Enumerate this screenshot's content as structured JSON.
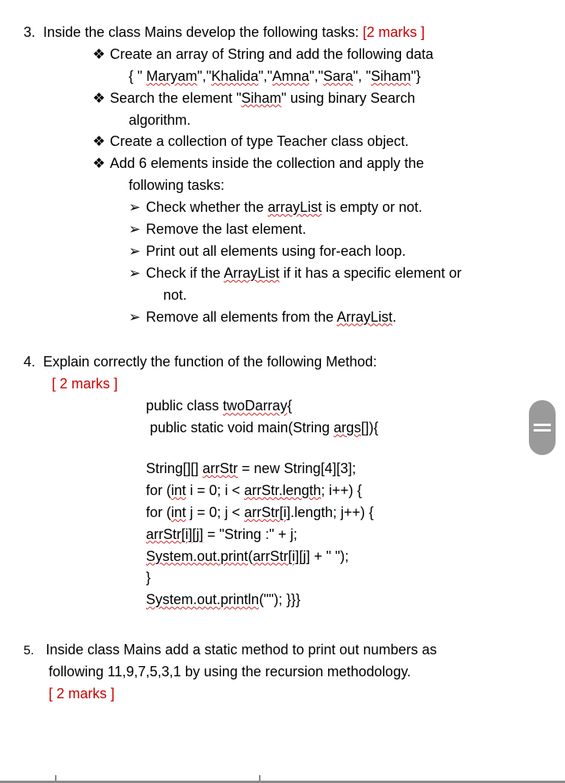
{
  "q3": {
    "number": "3.",
    "intro_before": "Inside the class Mains  develop the following tasks: ",
    "marks": "[2 marks ]",
    "b1_a": "Create an array of  String and add the following data",
    "b1_line2_open": "{ \" ",
    "b1_n1": "Maryam",
    "b1_sep1": "\",\"",
    "b1_n2": "Khalida",
    "b1_sep2": "\",\"",
    "b1_n3": "Amna",
    "b1_sep3": "\",\"",
    "b1_n4": "Sara",
    "b1_sep4": "\", \"",
    "b1_n5": "Siham",
    "b1_close": "\"}",
    "b2_a": "Search the element \"",
    "b2_s": "Siham",
    "b2_b": "\" using binary Search",
    "b2_line2": "algorithm.",
    "b3": "Create a collection of type Teacher class object.",
    "b4_a": "Add 6 elements inside the collection and apply the",
    "b4_line2": "following tasks:",
    "s1_a": "Check whether the ",
    "s1_u": "arrayList",
    "s1_b": " is empty or not.",
    "s2": "Remove the last element.",
    "s3": "Print out all elements using for-each loop.",
    "s4_a": "Check if the ",
    "s4_u": "ArrayList",
    "s4_b": " if it has a specific element or",
    "s4_line2": "not.",
    "s5_a": "Remove all elements from the ",
    "s5_u": "ArrayList",
    "s5_b": "."
  },
  "q4": {
    "number": "4.",
    "intro": "Explain correctly the function of the following Method:",
    "marks": "[ 2 marks ]",
    "c1_a": "public class ",
    "c1_u": "twoDarray",
    "c1_b": "{",
    "c2_a": " public static void main(String ",
    "c2_u": "args",
    "c2_b": "[]){",
    "c3_a": "String[][] ",
    "c3_u": "arrStr",
    "c3_b": " = new String[4][3];",
    "c4_a": "for (",
    "c4_u1": "int",
    "c4_b": " i = 0; i < ",
    "c4_u2": "arrStr.length",
    "c4_c": "; i++) {",
    "c5_a": "for (",
    "c5_u1": "int",
    "c5_b": " j = 0; j < ",
    "c5_u2": "arrStr[i]",
    "c5_c": ".length; j++) {",
    "c6_u": "arrStr[i][j]",
    "c6_b": " = \"String :\" + j;",
    "c7_u1": "System.out.print",
    "c7_a": "(",
    "c7_u2": "arrStr[i][j]",
    "c7_b": " + \" \");",
    "c8": "}",
    "c9_u": "System.out.println",
    "c9_b": "(\"\"); }}}"
  },
  "q5": {
    "number": "5.",
    "line1": "Inside class Mains add a static method to print out numbers as",
    "line2": "following 11,9,7,5,3,1   by using the recursion methodology.",
    "marks": "[ 2 marks ]"
  }
}
